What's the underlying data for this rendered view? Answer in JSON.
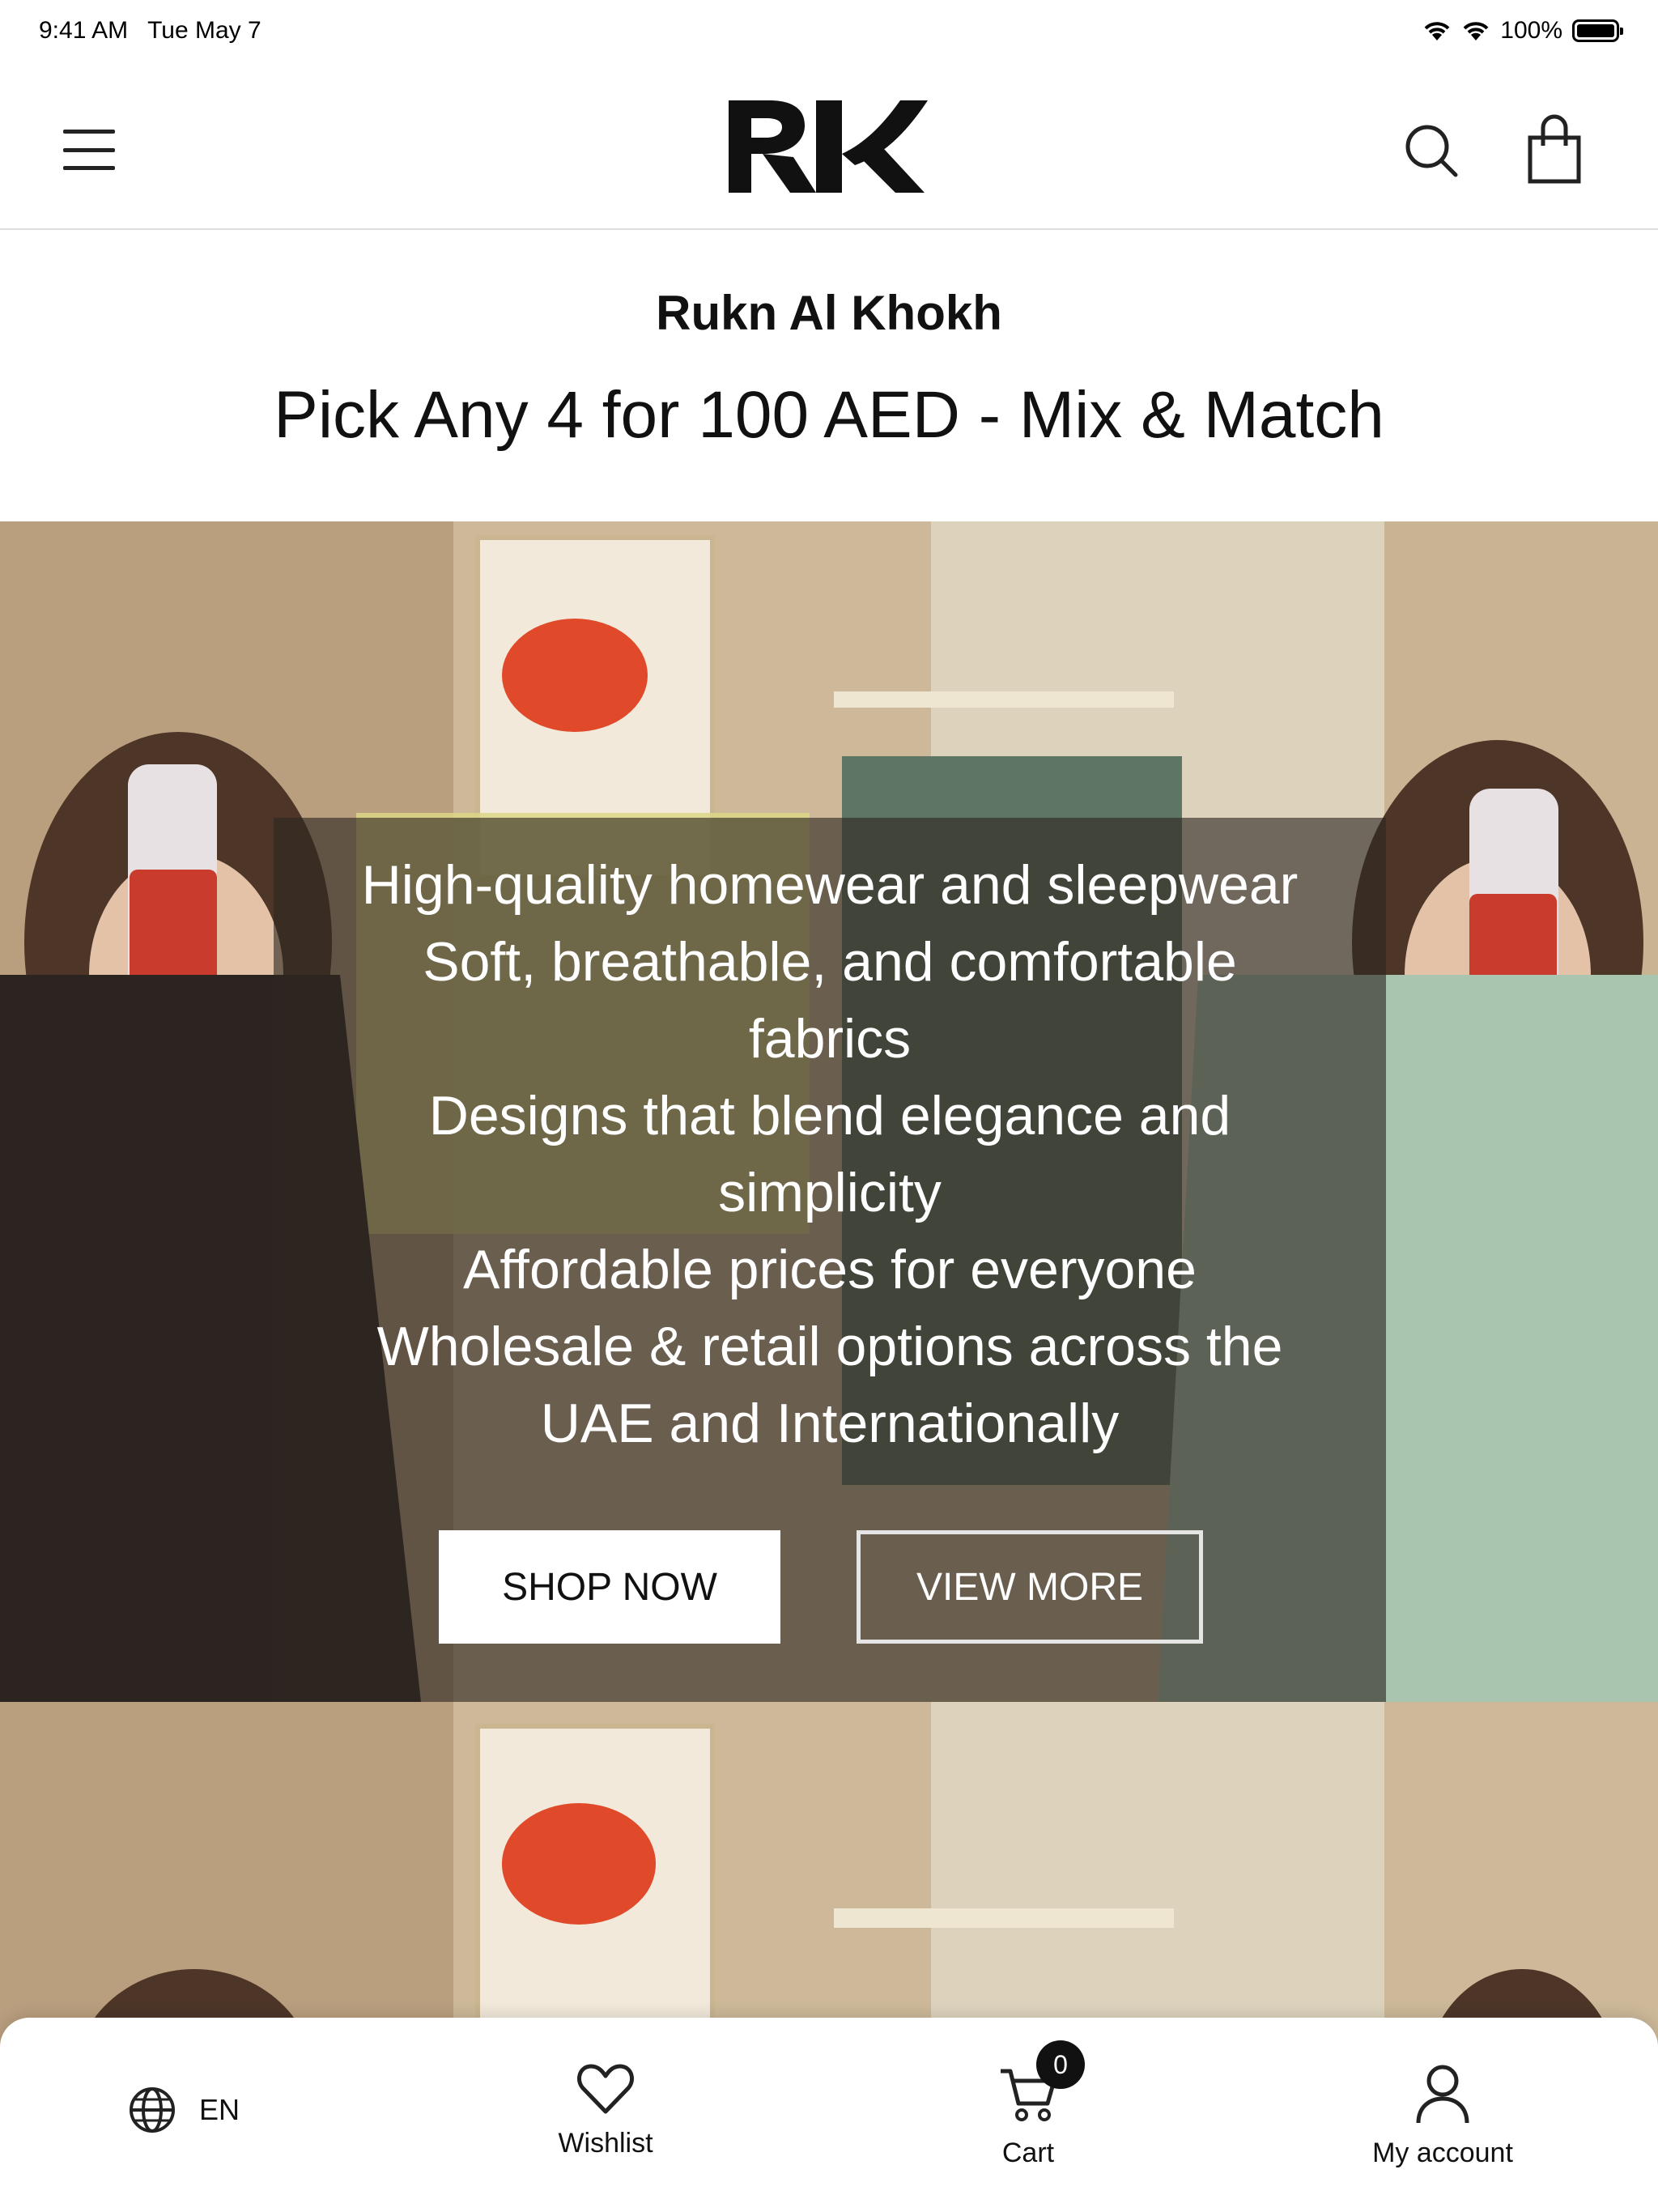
{
  "status_bar": {
    "time": "9:41 AM",
    "date": "Tue May 7",
    "battery": "100%"
  },
  "header": {
    "logo_alt": "RK",
    "icons": {
      "menu": "menu-icon",
      "search": "search-icon",
      "bag": "shopping-bag-icon"
    }
  },
  "store": {
    "name": "Rukn Al Khokh",
    "promo": "Pick Any 4 for 100 AED - Mix & Match"
  },
  "hero": {
    "features": [
      "High-quality homewear and sleepwear",
      "Soft, breathable, and comfortable",
      "fabrics",
      "Designs that blend elegance and",
      "simplicity",
      "Affordable prices for everyone",
      "Wholesale & retail options across the",
      "UAE and Internationally"
    ],
    "shop_now": "SHOP NOW",
    "view_more": "VIEW MORE"
  },
  "bottom_nav": {
    "language": "EN",
    "wishlist": "Wishlist",
    "cart": "Cart",
    "cart_count": "0",
    "account": "My account"
  },
  "colors": {
    "overlay": "#2d2620",
    "text": "#111111",
    "background": "#ffffff"
  }
}
